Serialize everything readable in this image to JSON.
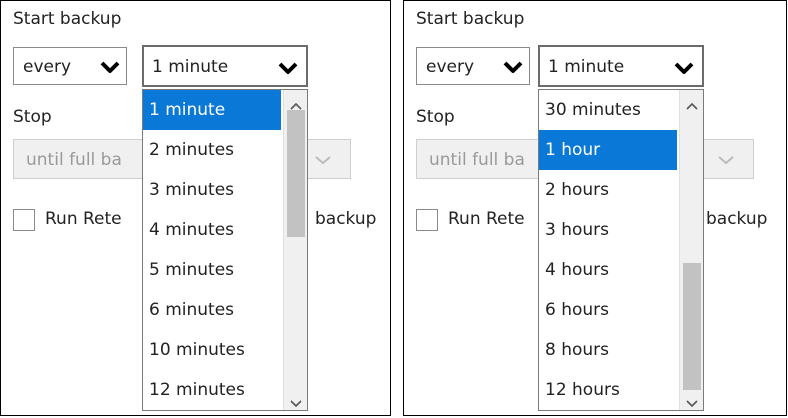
{
  "panels": [
    {
      "start_backup_label": "Start backup",
      "every_value": "every",
      "frequency_value": "1 minute",
      "stop_label": "Stop",
      "stop_value": "until full ba",
      "run_label_left": "Run Rete",
      "run_label_right": "backup",
      "dropdown": {
        "items": [
          "1 minute",
          "2 minutes",
          "3 minutes",
          "4 minutes",
          "5 minutes",
          "6 minutes",
          "10 minutes",
          "12 minutes"
        ],
        "selected_index": 0,
        "scroll_fraction": 0.0
      }
    },
    {
      "start_backup_label": "Start backup",
      "every_value": "every",
      "frequency_value": "1 minute",
      "stop_label": "Stop",
      "stop_value": "until full ba",
      "run_label_left": "Run Rete",
      "run_label_right": "backup",
      "dropdown": {
        "items": [
          "30 minutes",
          "1 hour",
          "2 hours",
          "3 hours",
          "4 hours",
          "6 hours",
          "8 hours",
          "12 hours"
        ],
        "selected_index": 1,
        "scroll_fraction": 1.0
      }
    }
  ],
  "colors": {
    "selected_bg": "#0a78d7",
    "scroll_thumb": "#c2c2c2"
  },
  "icons": {
    "caret": "chevron-down-icon",
    "scroll_up": "scroll-up-arrow-icon",
    "scroll_down": "scroll-down-arrow-icon"
  }
}
